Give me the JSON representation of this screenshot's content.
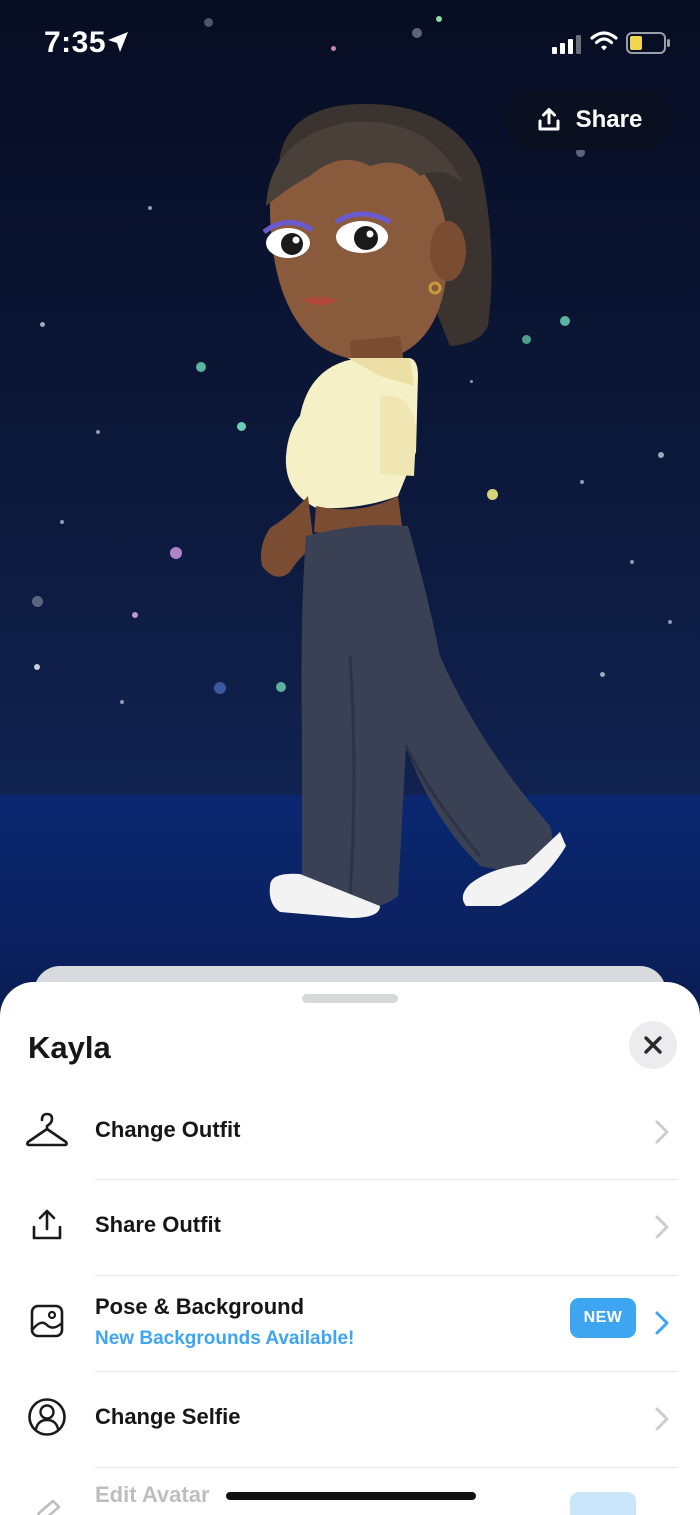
{
  "status_bar": {
    "time": "7:35"
  },
  "header": {
    "share_label": "Share"
  },
  "sheet": {
    "title": "Kayla",
    "items": [
      {
        "label": "Change Outfit",
        "icon": "hanger-icon"
      },
      {
        "label": "Share Outfit",
        "icon": "upload-icon"
      },
      {
        "label": "Pose & Background",
        "subtitle": "New Backgrounds Available!",
        "badge": "NEW",
        "icon": "image-icon"
      },
      {
        "label": "Change Selfie",
        "icon": "person-circle-icon"
      },
      {
        "label": "Edit Avatar",
        "icon": "edit-icon"
      }
    ]
  },
  "colors": {
    "accent": "#3ea5f0",
    "sky_top": "#070d22",
    "sky_horizon": "#1f4a9a",
    "sheet_bg": "#ffffff"
  }
}
